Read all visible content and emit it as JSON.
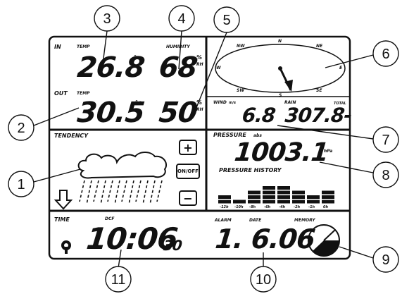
{
  "indoor": {
    "label": "IN",
    "temp_label": "TEMP",
    "humidity_label": "HUMIDITY",
    "temp_value": "26.8",
    "temp_unit": "°c",
    "humidity_value": "68",
    "humidity_unit": "%",
    "humidity_unit_sub": "RH"
  },
  "outdoor": {
    "label": "OUT",
    "temp_label": "TEMP",
    "temp_value": "30.5",
    "temp_unit": "°c",
    "humidity_value": "50",
    "humidity_unit": "%",
    "humidity_unit_sub": "RH"
  },
  "compass": {
    "directions": [
      "N",
      "NE",
      "E",
      "SE",
      "S",
      "SW",
      "W",
      "NW"
    ]
  },
  "wind": {
    "label": "WIND",
    "unit": "m/s",
    "value": "6.8"
  },
  "rain": {
    "label": "RAIN",
    "total_label": "TOTAL",
    "value": "307.8-"
  },
  "tendency": {
    "label": "TENDENCY",
    "buttons": {
      "plus": "+",
      "on_off": "ON/OFF",
      "minus": "−"
    }
  },
  "pressure": {
    "label": "PRESSURE",
    "unit_label": "abs",
    "value": "1003.1",
    "unit": "hPa",
    "history_label": "PRESSURE HISTORY",
    "history_ticks": [
      "-12h",
      "-10h",
      "-8h",
      "-6h",
      "-4h",
      "-2h",
      "-1h",
      "0h"
    ],
    "history_levels": [
      2,
      1,
      3,
      4,
      4,
      3,
      2,
      3
    ]
  },
  "time": {
    "label": "TIME",
    "dcf_label": "DCF",
    "value": "10:06",
    "seconds": "30"
  },
  "date": {
    "alarm_label": "ALARM",
    "date_label": "DATE",
    "memory_label": "MEMORY",
    "value": "1. 6.06"
  },
  "callouts": [
    "1",
    "2",
    "3",
    "4",
    "5",
    "6",
    "7",
    "8",
    "9",
    "10",
    "11"
  ]
}
